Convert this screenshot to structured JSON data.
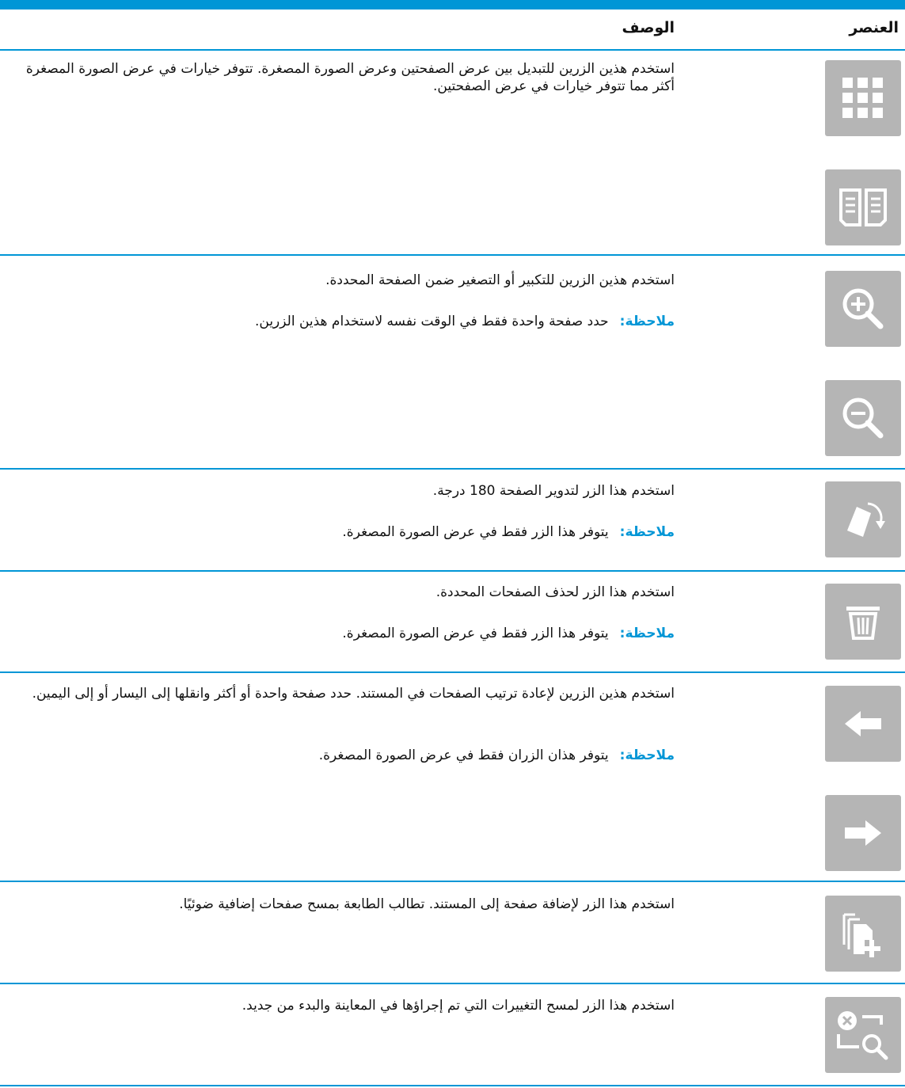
{
  "header": {
    "col_item": "العنصر",
    "col_description": "الوصف"
  },
  "rows": [
    {
      "buttons": [
        "thumbnail-view-icon",
        "two-page-view-icon"
      ],
      "description": "استخدم هذين الزرين للتبديل بين عرض الصفحتين وعرض الصورة المصغرة. تتوفر خيارات في عرض الصورة المصغرة أكثر مما تتوفر خيارات في عرض الصفحتين."
    },
    {
      "buttons": [
        "zoom-in-icon",
        "zoom-out-icon"
      ],
      "description": "استخدم هذين الزرين للتكبير أو التصغير ضمن الصفحة المحددة.",
      "note_label": "ملاحظة:",
      "note": "حدد صفحة واحدة فقط في الوقت نفسه لاستخدام هذين الزرين."
    },
    {
      "buttons": [
        "rotate-page-icon"
      ],
      "description": "استخدم هذا الزر لتدوير الصفحة 180 درجة.",
      "note_label": "ملاحظة:",
      "note": "يتوفر هذا الزر فقط في عرض الصورة المصغرة."
    },
    {
      "buttons": [
        "delete-icon"
      ],
      "description": "استخدم هذا الزر لحذف الصفحات المحددة.",
      "note_label": "ملاحظة:",
      "note": "يتوفر هذا الزر فقط في عرض الصورة المصغرة."
    },
    {
      "buttons": [
        "move-left-icon",
        "move-right-icon"
      ],
      "description": "استخدم هذين الزرين لإعادة ترتيب الصفحات في المستند. حدد صفحة واحدة أو أكثر وانقلها إلى اليسار أو إلى اليمين.",
      "note_label": "ملاحظة:",
      "note": "يتوفر هذان الزران فقط في عرض الصورة المصغرة."
    },
    {
      "buttons": [
        "add-page-icon"
      ],
      "description": "استخدم هذا الزر لإضافة صفحة إلى المستند. تطالب الطابعة بمسح صفحات إضافية ضوئيًا."
    },
    {
      "buttons": [
        "reset-preview-icon"
      ],
      "description": "استخدم هذا الزر لمسح التغييرات التي تم إجراؤها في المعاينة والبدء من جديد."
    }
  ]
}
